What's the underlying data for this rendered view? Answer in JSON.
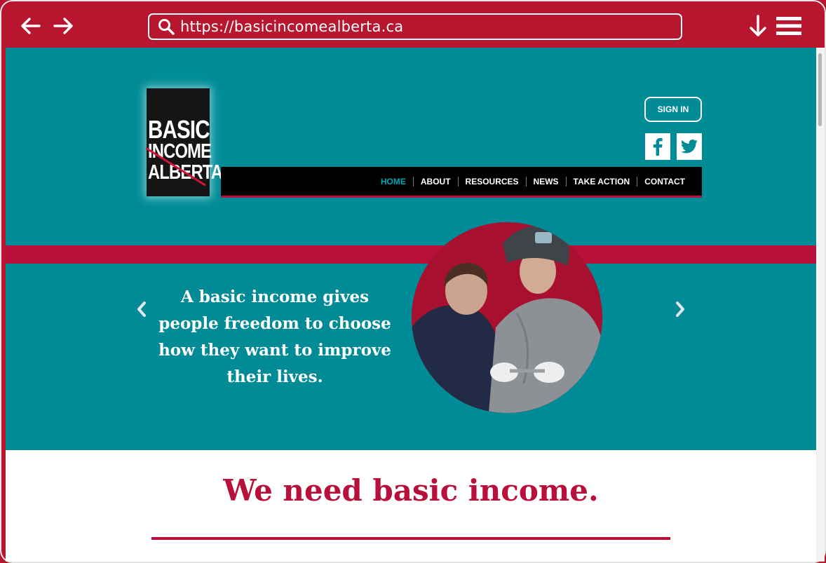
{
  "browser": {
    "url": "https://basicincomealberta.ca"
  },
  "header": {
    "logo": [
      "BASIC",
      "INCOME",
      "ALBERTA"
    ],
    "sign_in_label": "SIGN IN",
    "social": [
      "facebook-icon",
      "twitter-icon"
    ]
  },
  "nav": {
    "items": [
      {
        "label": "HOME",
        "active": true
      },
      {
        "label": "ABOUT"
      },
      {
        "label": "RESOURCES"
      },
      {
        "label": "NEWS"
      },
      {
        "label": "TAKE ACTION"
      },
      {
        "label": "CONTACT"
      }
    ]
  },
  "hero": {
    "quote": "A basic income gives people freedom to choose how they want to improve their lives."
  },
  "main": {
    "heading": "We need basic income."
  },
  "colors": {
    "brand_red": "#b8103a",
    "hero_teal": "#008b96",
    "nav_active": "#00a6b3"
  }
}
